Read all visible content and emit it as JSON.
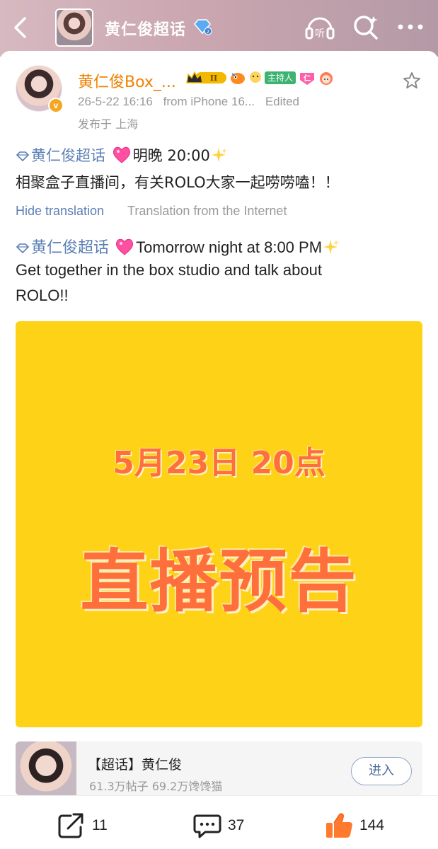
{
  "header": {
    "title": "黄仁俊超话",
    "listen_label": "听"
  },
  "post": {
    "author": "黄仁俊Box_...",
    "timestamp": "26-5-22 16:16",
    "source": "from iPhone 16...",
    "edited": "Edited",
    "location": "发布于 上海",
    "badge_host": "主持人",
    "badge_level": "II",
    "topic_tag": "黄仁俊超话",
    "cn_line1_text": "明晚 20:00",
    "cn_line2": "相聚盒子直播间，有关ROLO大家一起唠唠嗑！！",
    "hide_translation": "Hide translation",
    "translation_source": "Translation from the Internet",
    "en_line1_text": "Tomorrow night at 8:00 PM",
    "en_line2": "Get together in the box studio and talk about",
    "en_line3": "ROLO!!"
  },
  "poster": {
    "date": "5月23日  20点",
    "title": "直播预告",
    "background": "#fed216",
    "text_color": "#ff6f3c"
  },
  "topic_card": {
    "name": "【超话】黄仁俊",
    "stats": "61.3万帖子  69.2万馋馋猫",
    "enter_label": "进入"
  },
  "actions": {
    "share_count": "11",
    "comment_count": "37",
    "like_count": "144"
  },
  "colors": {
    "accent_link": "#5b7fb5",
    "username": "#f08200",
    "like": "#ff7a2e"
  }
}
